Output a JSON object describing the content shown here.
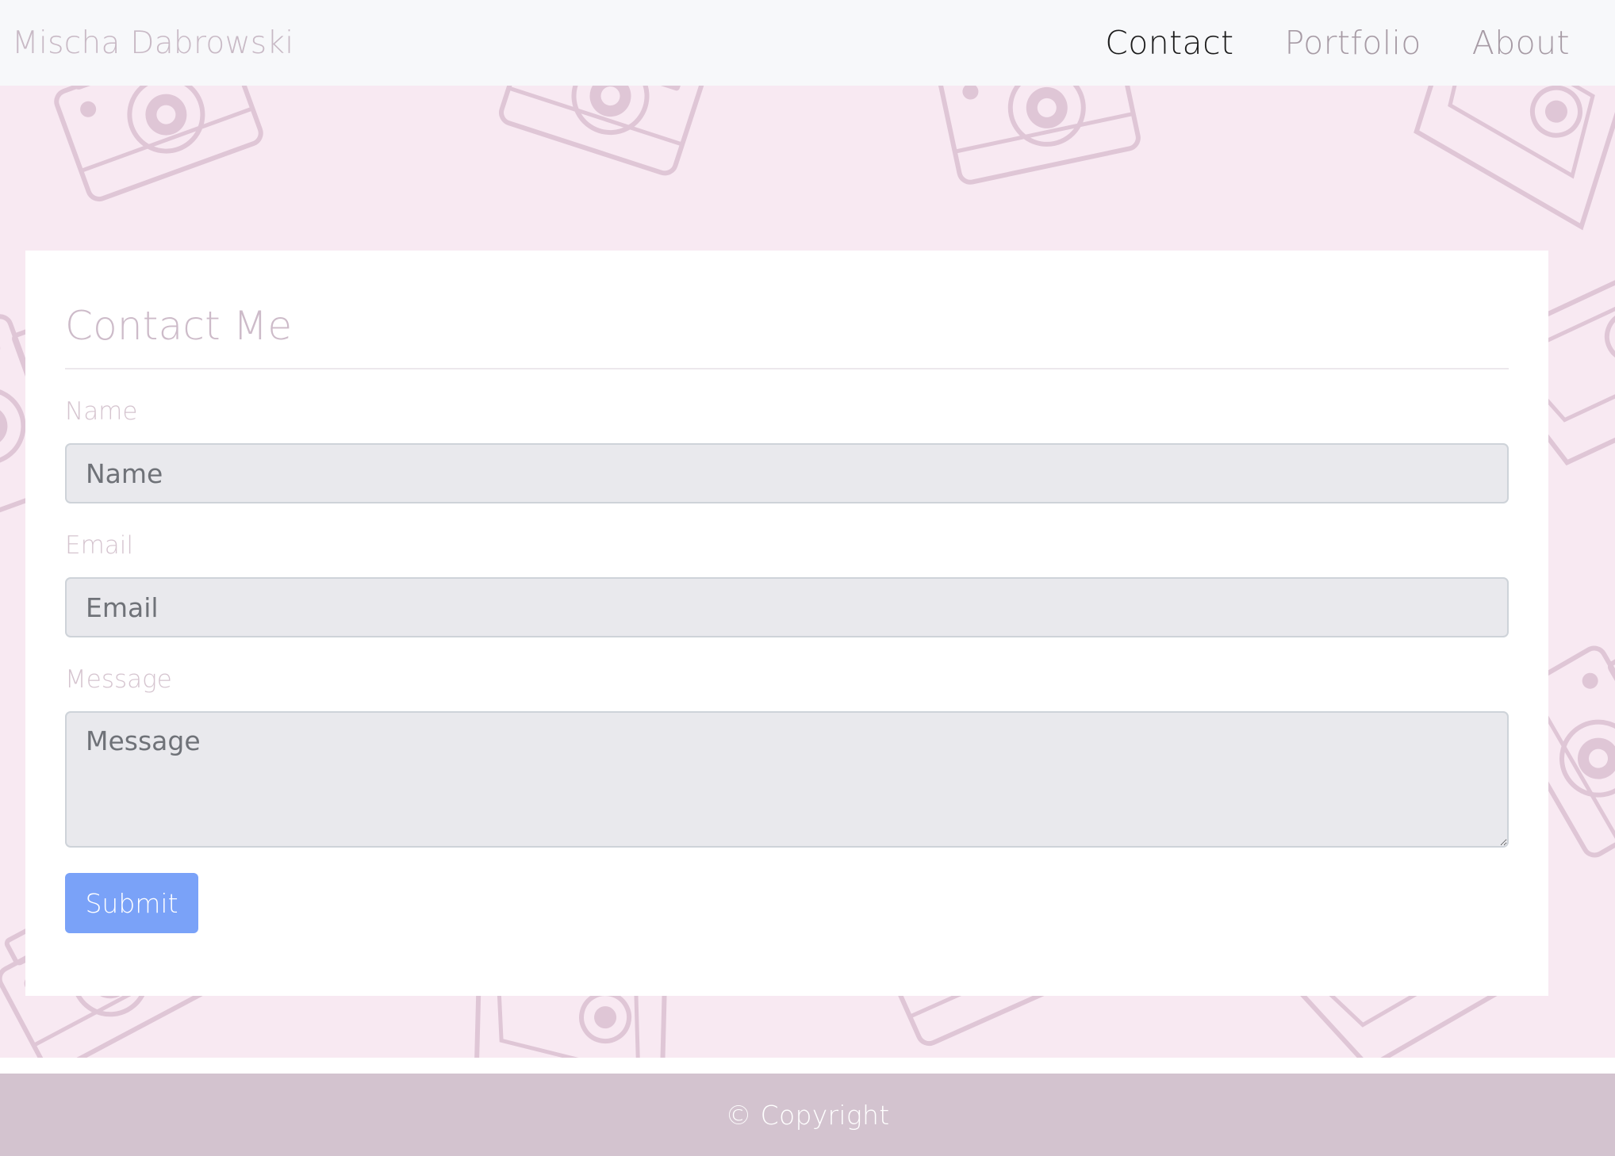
{
  "brand": {
    "name": "Mischa Dabrowski"
  },
  "nav": {
    "items": [
      {
        "label": "Contact",
        "active": true
      },
      {
        "label": "Portfolio",
        "active": false
      },
      {
        "label": "About",
        "active": false
      }
    ]
  },
  "form": {
    "title": "Contact Me",
    "name_label": "Name",
    "name_placeholder": "Name",
    "email_label": "Email",
    "email_placeholder": "Email",
    "message_label": "Message",
    "message_placeholder": "Message",
    "submit_label": "Submit"
  },
  "footer": {
    "copyright": "© Copyright"
  },
  "colors": {
    "hero_background": "#f8e9f2",
    "camera_pattern": "#dfc6d6",
    "submit_button": "#7aa2f8",
    "footer": "#d3c3cf"
  },
  "icons": {
    "background_pattern": "camera-icon"
  }
}
